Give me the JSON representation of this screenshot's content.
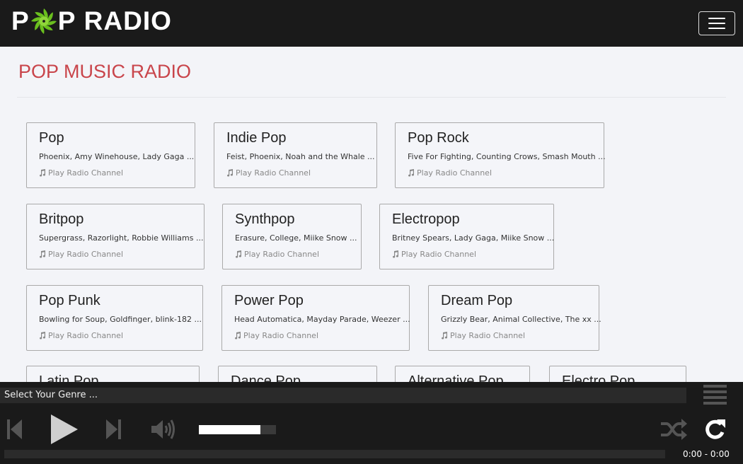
{
  "header": {
    "logo_p1": "P",
    "logo_p2": "P",
    "logo_rest": "RADIO",
    "menu_icon": "hamburger-icon",
    "accent": "#6abf1e"
  },
  "page": {
    "title": "POP MUSIC RADIO",
    "title_color": "#c9454b"
  },
  "cards": [
    {
      "title": "Pop",
      "artists": "Phoenix, Amy Winehouse, Lady Gaga ...",
      "play": "Play Radio Channel"
    },
    {
      "title": "Indie Pop",
      "artists": "Feist, Phoenix, Noah and the Whale ...",
      "play": "Play Radio Channel"
    },
    {
      "title": "Pop Rock",
      "artists": "Five For Fighting, Counting Crows, Smash Mouth ...",
      "play": "Play Radio Channel"
    },
    {
      "title": "Britpop",
      "artists": "Supergrass, Razorlight, Robbie Williams ...",
      "play": "Play Radio Channel"
    },
    {
      "title": "Synthpop",
      "artists": "Erasure, College, Miike Snow ...",
      "play": "Play Radio Channel"
    },
    {
      "title": "Electropop",
      "artists": "Britney Spears, Lady Gaga, Miike Snow ...",
      "play": "Play Radio Channel"
    },
    {
      "title": "Pop Punk",
      "artists": "Bowling for Soup, Goldfinger, blink-182 ...",
      "play": "Play Radio Channel"
    },
    {
      "title": "Power Pop",
      "artists": "Head Automatica, Mayday Parade, Weezer ...",
      "play": "Play Radio Channel"
    },
    {
      "title": "Dream Pop",
      "artists": "Grizzly Bear, Animal Collective, The xx ...",
      "play": "Play Radio Channel"
    },
    {
      "title": "Latin Pop",
      "artists": "",
      "play": ""
    },
    {
      "title": "Dance Pop",
      "artists": "",
      "play": ""
    },
    {
      "title": "Alternative Pop",
      "artists": "",
      "play": ""
    },
    {
      "title": "Electro Pop",
      "artists": "",
      "play": ""
    }
  ],
  "player": {
    "now_playing": "Select Your Genre ...",
    "time": "0:00 - 0:00",
    "volume": 0.8,
    "progress": 0,
    "icons": [
      "previous-icon",
      "play-icon",
      "next-icon",
      "volume-icon",
      "shuffle-icon",
      "repeat-icon",
      "playlist-icon"
    ]
  }
}
